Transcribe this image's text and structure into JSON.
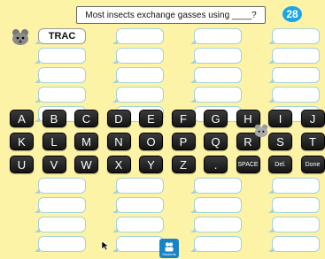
{
  "question": "Most insects exchange gasses using ____?",
  "round_number": "28",
  "answer_columns": [
    [
      "TRAC",
      "",
      "",
      "",
      ""
    ],
    [
      "",
      "",
      "",
      "",
      ""
    ],
    [
      "",
      "",
      "",
      "",
      ""
    ],
    [
      "",
      "",
      "",
      "",
      ""
    ]
  ],
  "lower_columns": [
    [
      "",
      "",
      "",
      ""
    ],
    [
      "",
      "",
      "",
      ""
    ],
    [
      "",
      "",
      "",
      ""
    ],
    [
      "",
      "",
      "",
      ""
    ]
  ],
  "keyboard": {
    "row1": [
      "A",
      "B",
      "C",
      "D",
      "E",
      "F",
      "G",
      "H",
      "I",
      "J"
    ],
    "row2": [
      "K",
      "L",
      "M",
      "N",
      "O",
      "P",
      "Q",
      "R",
      "S",
      "T"
    ],
    "row3": [
      "U",
      "V",
      "W",
      "X",
      "Y",
      "Z",
      ".",
      "SPACE",
      "Del.",
      "Done"
    ]
  },
  "students_label": "Students",
  "colors": {
    "background": "#fdf3a7",
    "badge": "#1aa6e6",
    "key": "#1f1f1f",
    "box_border": "#a5d3d8"
  }
}
